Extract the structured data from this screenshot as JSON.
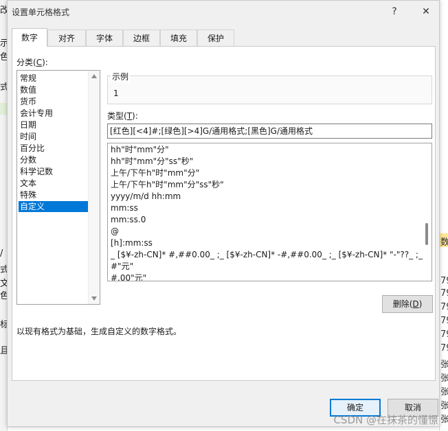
{
  "dialog": {
    "title": "设置单元格格式",
    "help_label": "?",
    "close_label": "✕"
  },
  "tabs": [
    "数字",
    "对齐",
    "字体",
    "边框",
    "填充",
    "保护"
  ],
  "category": {
    "label_prefix": "分类(",
    "label_key": "C",
    "label_suffix": "):",
    "items": [
      "常规",
      "数值",
      "货币",
      "会计专用",
      "日期",
      "时间",
      "百分比",
      "分数",
      "科学记数",
      "文本",
      "特殊",
      "自定义"
    ],
    "selected": "自定义"
  },
  "sample": {
    "legend": "示例",
    "value": "1"
  },
  "type": {
    "label_prefix": "类型(",
    "label_key": "T",
    "label_suffix": "):",
    "input_value": "[红色][<4]#;[绿色][>4]G/通用格式;[黑色]G/通用格式",
    "formats": [
      "hh\"时\"mm\"分\"",
      "hh\"时\"mm\"分\"ss\"秒\"",
      "上午/下午h\"时\"mm\"分\"",
      "上午/下午h\"时\"mm\"分\"ss\"秒\"",
      "yyyy/m/d hh:mm",
      "mm:ss",
      "mm:ss.0",
      "@",
      "[h]:mm:ss",
      "_ [$¥-zh-CN]* #,##0.00_ ;_ [$¥-zh-CN]* -#,##0.00_ ;_ [$¥-zh-CN]* \"-\"??_ ;_ @_",
      "#\"元\"",
      "#.00\"元\""
    ]
  },
  "delete_button": {
    "label": "删除(",
    "key": "D",
    "suffix": ")"
  },
  "description": "以现有格式为基础，生成自定义的数字格式。",
  "ok_button": "确定",
  "cancel_button": "取消",
  "watermark": "CSDN @在抹茶的懂憬",
  "background": {
    "left_glyphs": [
      "改",
      "示",
      "色",
      "式",
      "/",
      "式",
      "文",
      "色",
      "标",
      "且"
    ],
    "right_glyphs": [
      "数",
      "79",
      "79",
      "79",
      "79",
      "79",
      "79",
      "张",
      "张",
      "张",
      "张",
      "张"
    ]
  },
  "colors": {
    "selection": "#0078d7",
    "primary_border": "#0078d7"
  }
}
